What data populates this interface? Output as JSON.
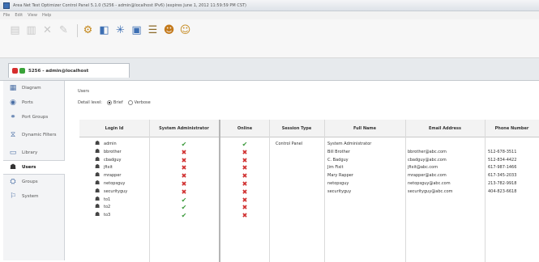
{
  "window": {
    "title": "Area Net Test Optimizer Control Panel 5.1.0 (5256 - admin@localhost IPv6) (expires June 1, 2012 11:59:59 PM CST)"
  },
  "menu": [
    "File",
    "Edit",
    "View",
    "Help"
  ],
  "doc_tab": {
    "label": "5256 - admin@localhost"
  },
  "sidebar": {
    "items": [
      {
        "label": "Diagram",
        "icon": "diagram-icon"
      },
      {
        "label": "Ports",
        "icon": "ports-icon"
      },
      {
        "label": "Port Groups",
        "icon": "port-groups-icon"
      },
      {
        "label": "Dynamic Filters",
        "icon": "filter-icon"
      },
      {
        "label": "Library",
        "icon": "library-icon"
      },
      {
        "label": "Users",
        "icon": "users-icon"
      },
      {
        "label": "Groups",
        "icon": "groups-icon"
      },
      {
        "label": "System",
        "icon": "system-icon"
      }
    ],
    "selected": "Users"
  },
  "users_panel": {
    "title": "Users",
    "detail_level_label": "Detail level:",
    "detail_options": [
      "Brief",
      "Verbose"
    ],
    "detail_selected": "Brief"
  },
  "table": {
    "columns": [
      "Login Id",
      "System Administrator",
      "Online",
      "Session Type",
      "Full Name",
      "Email Address",
      "Phone Number"
    ],
    "rows": [
      {
        "login": "admin",
        "admin": true,
        "online": true,
        "session": "Control Panel",
        "name": "System Administrator",
        "email": "",
        "phone": ""
      },
      {
        "login": "bbrother",
        "admin": false,
        "online": false,
        "session": "",
        "name": "Bill Brother",
        "email": "bbrother@abc.com",
        "phone": "512-678-3511"
      },
      {
        "login": "cbadguy",
        "admin": false,
        "online": false,
        "session": "",
        "name": "C. Badguy",
        "email": "cbadguy@abc.com",
        "phone": "512-834-4422"
      },
      {
        "login": "jfixit",
        "admin": false,
        "online": false,
        "session": "",
        "name": "Jim Fixit",
        "email": "jfixit@abc.com",
        "phone": "617-987-1466"
      },
      {
        "login": "mrapper",
        "admin": false,
        "online": false,
        "session": "",
        "name": "Mary Rapper",
        "email": "mrapper@abc.com",
        "phone": "617-345-2033"
      },
      {
        "login": "netopsguy",
        "admin": false,
        "online": false,
        "session": "",
        "name": "netopsguy",
        "email": "netopsguy@abc.com",
        "phone": "213-782-9918"
      },
      {
        "login": "securityguy",
        "admin": false,
        "online": false,
        "session": "",
        "name": "securityguy",
        "email": "securityguy@abc.com",
        "phone": "404-823-6618"
      },
      {
        "login": "to1",
        "admin": true,
        "online": false,
        "session": "",
        "name": "",
        "email": "",
        "phone": ""
      },
      {
        "login": "to2",
        "admin": true,
        "online": false,
        "session": "",
        "name": "",
        "email": "",
        "phone": ""
      },
      {
        "login": "to3",
        "admin": true,
        "online": false,
        "session": "",
        "name": "",
        "email": "",
        "phone": ""
      }
    ]
  },
  "colors": {
    "check": "#3c9a3c",
    "cross": "#d02f2f",
    "accent": "#3d6fb3"
  }
}
